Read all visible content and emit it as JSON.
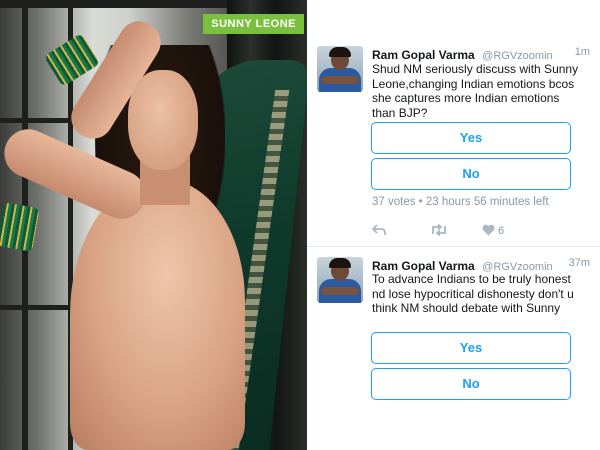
{
  "photo": {
    "label": "SUNNY LEONE"
  },
  "tweets": [
    {
      "name": "Ram Gopal Varma",
      "handle": "@RGVzoomin",
      "time": "1m",
      "text": "Shud NM seriously discuss with Sunny Leone,changing Indian emotions bcos she captures more Indian emotions than BJP?",
      "options": [
        "Yes",
        "No"
      ],
      "meta": "37 votes • 23 hours 56 minutes left",
      "likes": "6"
    },
    {
      "name": "Ram Gopal Varma",
      "handle": "@RGVzoomin",
      "time": "37m",
      "text": "To advance Indians to be truly honest nd lose hypocritical dishonesty don't u think NM should debate with Sunny",
      "options": [
        "Yes",
        "No"
      ]
    }
  ],
  "colors": {
    "accent": "#1da1f2",
    "muted": "#8899a6",
    "label_bg": "#7bbf3f"
  },
  "icons": [
    "reply-icon",
    "retweet-icon",
    "like-icon"
  ]
}
